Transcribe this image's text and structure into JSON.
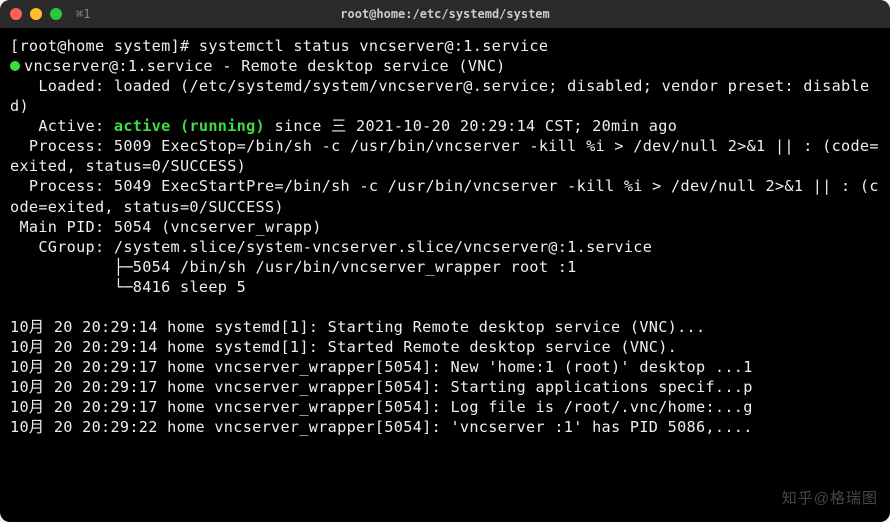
{
  "window": {
    "tab": "⌘1",
    "title": "root@home:/etc/systemd/system"
  },
  "prompt": {
    "text": "[root@home system]#",
    "command": "systemctl status vncserver@:1.service"
  },
  "status": {
    "unit_line_prefix": "vncserver@:1.service - Remote desktop service (VNC)",
    "loaded": "   Loaded: loaded (/etc/systemd/system/vncserver@.service; disabled; vendor preset: disabled)",
    "active_label": "   Active: ",
    "active_value": "active (running)",
    "active_since": " since 三 2021-10-20 20:29:14 CST; 20min ago",
    "process1": "  Process: 5009 ExecStop=/bin/sh -c /usr/bin/vncserver -kill %i > /dev/null 2>&1 || : (code=exited, status=0/SUCCESS)",
    "process2": "  Process: 5049 ExecStartPre=/bin/sh -c /usr/bin/vncserver -kill %i > /dev/null 2>&1 || : (code=exited, status=0/SUCCESS)",
    "mainpid": " Main PID: 5054 (vncserver_wrapp)",
    "cgroup": "   CGroup: /system.slice/system-vncserver.slice/vncserver@:1.service",
    "tree1": "           ├─5054 /bin/sh /usr/bin/vncserver_wrapper root :1",
    "tree2": "           └─8416 sleep 5"
  },
  "logs": [
    "10月 20 20:29:14 home systemd[1]: Starting Remote desktop service (VNC)...",
    "10月 20 20:29:14 home systemd[1]: Started Remote desktop service (VNC).",
    "10月 20 20:29:17 home vncserver_wrapper[5054]: New 'home:1 (root)' desktop ...1",
    "10月 20 20:29:17 home vncserver_wrapper[5054]: Starting applications specif...p",
    "10月 20 20:29:17 home vncserver_wrapper[5054]: Log file is /root/.vnc/home:...g",
    "10月 20 20:29:22 home vncserver_wrapper[5054]: 'vncserver :1' has PID 5086,...."
  ],
  "watermark": "知乎@格瑞图"
}
